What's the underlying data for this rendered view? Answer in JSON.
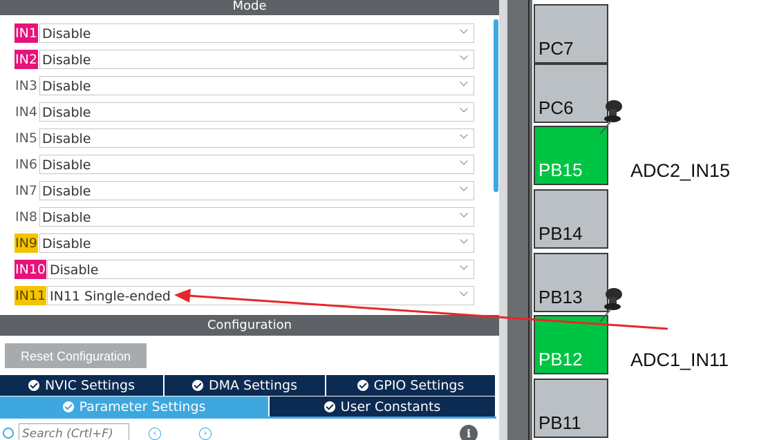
{
  "mode_panel": {
    "title": "Mode",
    "rows": [
      {
        "label": "IN1",
        "value": "Disable",
        "highlight": "pink"
      },
      {
        "label": "IN2",
        "value": "Disable",
        "highlight": "pink"
      },
      {
        "label": "IN3",
        "value": "Disable",
        "highlight": "none"
      },
      {
        "label": "IN4",
        "value": "Disable",
        "highlight": "none"
      },
      {
        "label": "IN5",
        "value": "Disable",
        "highlight": "none"
      },
      {
        "label": "IN6",
        "value": "Disable",
        "highlight": "none"
      },
      {
        "label": "IN7",
        "value": "Disable",
        "highlight": "none"
      },
      {
        "label": "IN8",
        "value": "Disable",
        "highlight": "none"
      },
      {
        "label": "IN9",
        "value": "Disable",
        "highlight": "yellow"
      },
      {
        "label": "IN10",
        "value": "Disable",
        "highlight": "pink"
      },
      {
        "label": "IN11",
        "value": "IN11 Single-ended",
        "highlight": "yellow"
      }
    ]
  },
  "config_panel": {
    "title": "Configuration",
    "reset_label": "Reset Configuration",
    "tabs_row1": [
      "NVIC Settings",
      "DMA Settings",
      "GPIO Settings"
    ],
    "tabs_row2": [
      "Parameter Settings",
      "User Constants"
    ],
    "active_tab": "Parameter Settings",
    "search_placeholder": "Search (Crtl+F)",
    "info_glyph": "i",
    "nav_prev_glyph": "‹",
    "nav_next_glyph": "›"
  },
  "chip": {
    "pins": [
      {
        "name": "PC7",
        "color": "gray"
      },
      {
        "name": "PC6",
        "color": "gray"
      },
      {
        "name": "PB15",
        "color": "green"
      },
      {
        "name": "PB14",
        "color": "gray"
      },
      {
        "name": "PB13",
        "color": "gray"
      },
      {
        "name": "PB12",
        "color": "green"
      },
      {
        "name": "PB11",
        "color": "gray"
      }
    ],
    "labels": {
      "PB15": "ADC2_IN15",
      "PB12": "ADC1_IN11"
    }
  },
  "colors": {
    "pink": "#e5137a",
    "yellow": "#f5c400",
    "pin_green": "#00c444",
    "pin_gray": "#bbc0c4",
    "tab_dark": "#0c2b52",
    "tab_active": "#3ea7e0",
    "annotation_arrow": "#e8262b"
  },
  "icons": [
    "chevron-down-icon",
    "check-circle-icon",
    "search-icon",
    "info-icon",
    "pushpin-icon",
    "nav-prev-icon",
    "nav-next-icon"
  ]
}
